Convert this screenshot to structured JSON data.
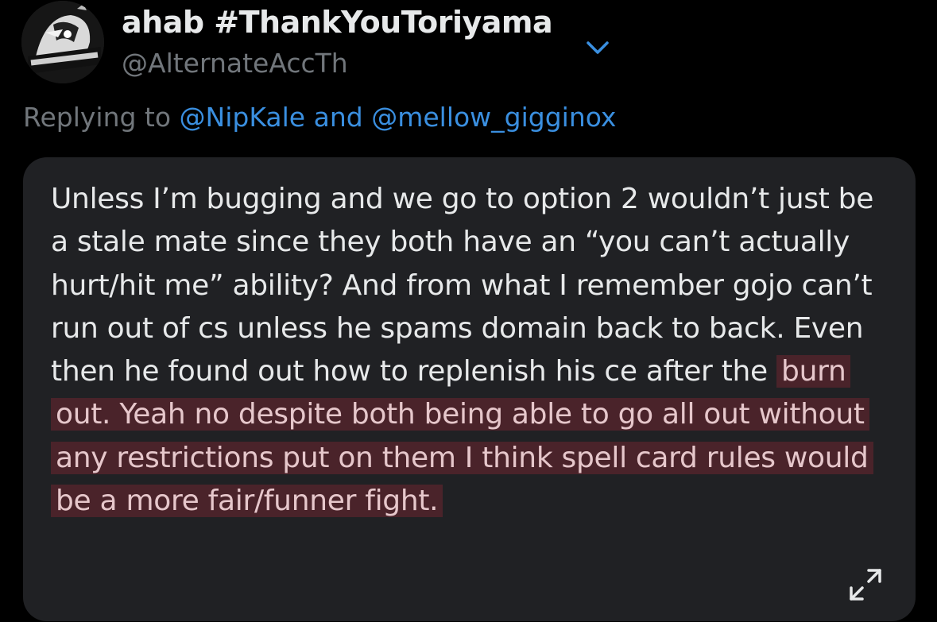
{
  "tweet": {
    "author": {
      "display_name": "ahab #ThankYouToriyama",
      "handle": "@AlternateAccTh",
      "avatar_icon": "avatar-image"
    },
    "replying_to": {
      "prefix": "Replying to",
      "user1": "@NipKale",
      "conjunction": "and",
      "user2": "@mellow_gigginox"
    },
    "text_plain": "Unless I’m bugging and we go to option 2 wouldn’t just be a stale mate since they both have an “you can’t actually hurt/hit me” ability? And from what I remember gojo can’t run out of cs unless he spams domain back to back. Even then he found out how to replenish his ce after the",
    "text_highlighted": "burn out. Yeah no despite both being able to go all out without any restrictions put on them I think spell card rules would be a more fair/funner fight."
  },
  "icons": {
    "chevron": "chevron-down-icon",
    "expand": "expand-icon"
  },
  "colors": {
    "background": "#000000",
    "bubble": "#202124",
    "link": "#3a8fe0",
    "muted": "#71767b",
    "highlight": "#4a232a"
  }
}
